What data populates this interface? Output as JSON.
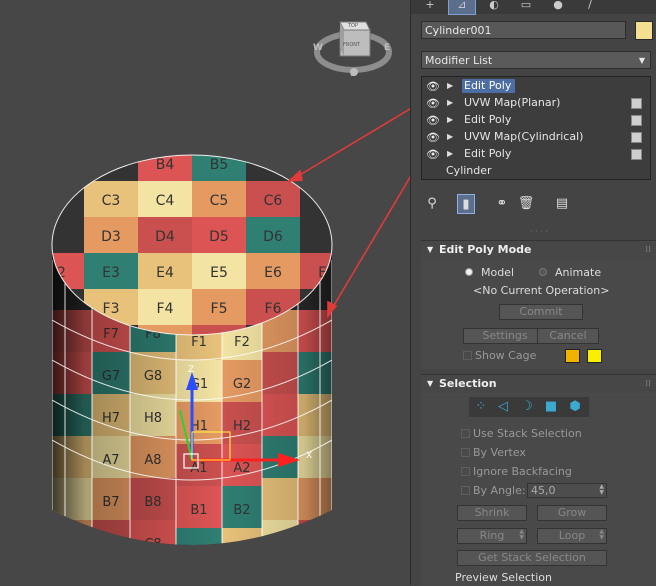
{
  "viewcube": {
    "face_top": "TOP",
    "face_front": "FRONT",
    "compass_w": "W",
    "compass_e": "E",
    "compass_s": "S"
  },
  "grid": {
    "rows": [
      "B",
      "C",
      "D",
      "E",
      "F",
      "G",
      "H",
      "A"
    ],
    "top_cap": [
      [
        "B4",
        "B5"
      ],
      [
        "C3",
        "C4",
        "C5",
        "C6"
      ],
      [
        "D3",
        "D4",
        "D5",
        "D6"
      ],
      [
        "E2",
        "E3",
        "E4",
        "E5",
        "E6",
        "E7"
      ],
      [
        "F3",
        "F4",
        "F5",
        "F6"
      ],
      [
        "G4",
        "G5"
      ]
    ],
    "side_rows": [
      [
        "F7",
        "F8",
        "F1",
        "F2"
      ],
      [
        "G7",
        "G8",
        "G1",
        "G2"
      ],
      [
        "H7",
        "H8",
        "H1",
        "H2"
      ],
      [
        "A7",
        "A8",
        "A1",
        "A2"
      ],
      [
        "B7",
        "B8",
        "B1",
        "B2"
      ],
      [
        "C7",
        "C8",
        "C1",
        "C2"
      ]
    ]
  },
  "gizmo": {
    "axis_z": "Z",
    "axis_x": "X"
  },
  "panel": {
    "tabs": [
      "+",
      "⊿",
      "◐",
      "▭",
      "●",
      "/"
    ],
    "object_name": "Cylinder001",
    "object_color": "#f2df8f",
    "modifier_list_label": "Modifier List",
    "stack": [
      {
        "label": "Edit Poly",
        "selected": true
      },
      {
        "label": "UVW Map(Planar)",
        "selected": false
      },
      {
        "label": "Edit Poly",
        "selected": false
      },
      {
        "label": "UVW Map(Cylindrical)",
        "selected": false
      },
      {
        "label": "Edit Poly",
        "selected": false
      }
    ],
    "base_object": "Cylinder",
    "edit_poly_mode": {
      "title": "Edit Poly Mode",
      "model": "Model",
      "animate": "Animate",
      "operation": "<No Current Operation>",
      "commit": "Commit",
      "settings": "Settings",
      "cancel": "Cancel",
      "show_cage": "Show Cage",
      "cage_color_1": "#f0b400",
      "cage_color_2": "#f8f000"
    },
    "selection": {
      "title": "Selection",
      "use_stack": "Use Stack Selection",
      "by_vertex": "By Vertex",
      "ignore_backfacing": "Ignore Backfacing",
      "by_angle": "By Angle:",
      "angle_value": "45,0",
      "shrink": "Shrink",
      "grow": "Grow",
      "ring": "Ring",
      "loop": "Loop",
      "get_stack": "Get Stack Selection",
      "preview": "Preview Selection"
    }
  },
  "colors": {
    "viewport_bg": "#474747",
    "selection_blue": "#4c6ea5",
    "arrow_red": "#e03a3a"
  }
}
